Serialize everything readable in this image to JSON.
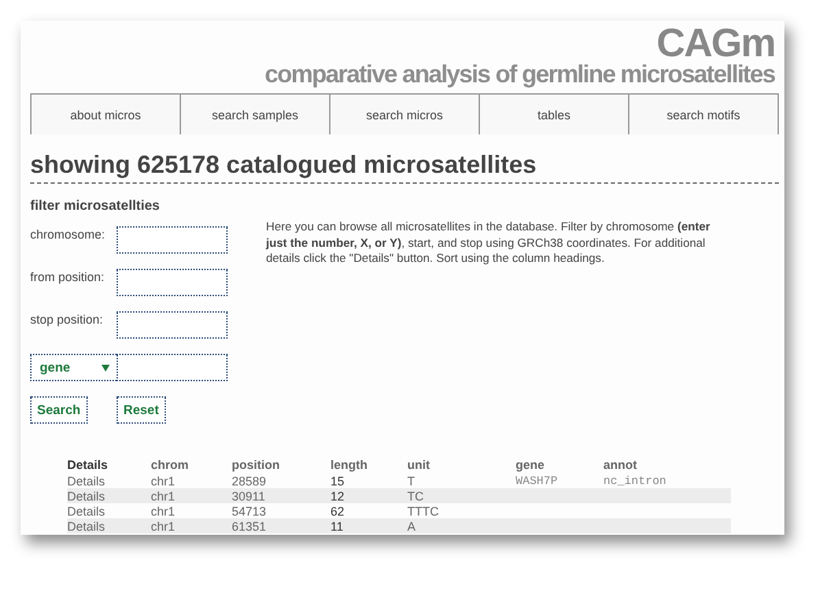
{
  "header": {
    "logo": "CAGm",
    "subtitle": "comparative analysis of germline microsatellites"
  },
  "nav": [
    {
      "label": "about micros",
      "selected": false
    },
    {
      "label": "search samples",
      "selected": false
    },
    {
      "label": "search micros",
      "selected": false
    },
    {
      "label": "tables",
      "selected": false
    },
    {
      "label": "search motifs",
      "selected": false
    }
  ],
  "heading": "showing 625178 catalogued microsatellites",
  "filter": {
    "title": "filter microsatellties",
    "fields": [
      {
        "label": "chromosome:"
      },
      {
        "label": "from position:"
      },
      {
        "label": "stop position:"
      }
    ],
    "selector": {
      "value": "gene"
    },
    "buttons": [
      "Search",
      "Reset"
    ],
    "help": "Here you can browse all microsatellites in the database. Filter by chromosome **(enter just the number, X, or Y)**, start, and stop using GRCh38 coordinates. For additional details click the \"Details\" button. Sort using the column headings."
  },
  "table": {
    "columns": [
      "Details",
      "chrom",
      "position",
      "length",
      "unit",
      "gene",
      "annot"
    ],
    "rows": [
      [
        "Details",
        "chr1",
        "28589",
        "15",
        "T",
        "WASH7P",
        "nc_intron"
      ],
      [
        "Details",
        "chr1",
        "30911",
        "12",
        "TC",
        "",
        ""
      ],
      [
        "Details",
        "chr1",
        "54713",
        "62",
        "TTTC",
        "",
        ""
      ],
      [
        "Details",
        "chr1",
        "61351",
        "11",
        "A",
        "",
        ""
      ]
    ]
  }
}
